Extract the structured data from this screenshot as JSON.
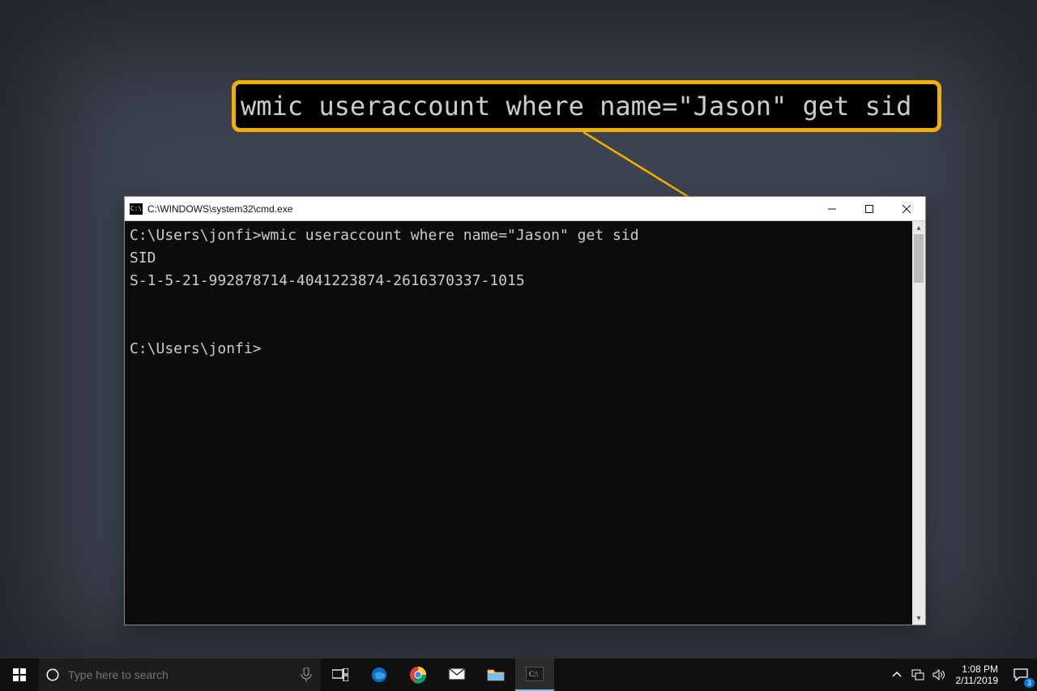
{
  "callout": {
    "command": "wmic useraccount where name=\"Jason\" get sid"
  },
  "cmd": {
    "title": "C:\\WINDOWS\\system32\\cmd.exe",
    "lines": {
      "l1": "C:\\Users\\jonfi>wmic useraccount where name=\"Jason\" get sid",
      "l2": "SID",
      "l3": "S-1-5-21-992878714-4041223874-2616370337-1015",
      "l4": "",
      "l5": "",
      "l6": "C:\\Users\\jonfi>"
    }
  },
  "taskbar": {
    "search_placeholder": "Type here to search",
    "time": "1:08 PM",
    "date": "2/11/2019",
    "notification_count": "3"
  }
}
